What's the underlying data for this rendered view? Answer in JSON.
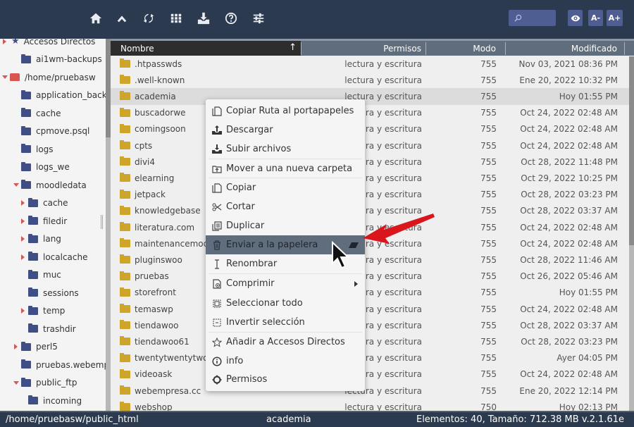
{
  "toolbar": {
    "icons": [
      {
        "name": "home-icon"
      },
      {
        "name": "up-icon"
      },
      {
        "name": "refresh-icon"
      },
      {
        "name": "grid-view-icon"
      },
      {
        "name": "download-icon"
      },
      {
        "name": "help-icon"
      },
      {
        "name": "settings-sliders-icon"
      }
    ],
    "search_placeholder": "",
    "font_decrease_label": "A-",
    "font_increase_label": "A+"
  },
  "sidebar": {
    "items": [
      {
        "label": "Accesos Directos",
        "icon": "star-icon",
        "arrow": "right",
        "level": 0
      },
      {
        "label": "ai1wm-backups",
        "icon": "folder-icon",
        "arrow": "none",
        "level": 1
      },
      {
        "label": "/home/pruebasw",
        "icon": "drive-icon",
        "arrow": "down",
        "level": 0
      },
      {
        "label": "application_backups",
        "icon": "folder-icon",
        "arrow": "none",
        "level": 1
      },
      {
        "label": "cache",
        "icon": "folder-icon",
        "arrow": "none",
        "level": 1
      },
      {
        "label": "cpmove.psql",
        "icon": "folder-icon",
        "arrow": "none",
        "level": 1
      },
      {
        "label": "logs",
        "icon": "folder-icon",
        "arrow": "none",
        "level": 1
      },
      {
        "label": "logs_we",
        "icon": "folder-icon",
        "arrow": "none",
        "level": 1
      },
      {
        "label": "moodledata",
        "icon": "folder-icon",
        "arrow": "down",
        "level": 1
      },
      {
        "label": "cache",
        "icon": "folder-icon",
        "arrow": "right",
        "level": 2
      },
      {
        "label": "filedir",
        "icon": "folder-icon",
        "arrow": "right",
        "level": 2
      },
      {
        "label": "lang",
        "icon": "folder-icon",
        "arrow": "right",
        "level": 2
      },
      {
        "label": "localcache",
        "icon": "folder-icon",
        "arrow": "right",
        "level": 2
      },
      {
        "label": "muc",
        "icon": "folder-icon",
        "arrow": "none",
        "level": 2
      },
      {
        "label": "sessions",
        "icon": "folder-icon",
        "arrow": "none",
        "level": 2
      },
      {
        "label": "temp",
        "icon": "folder-icon",
        "arrow": "right",
        "level": 2
      },
      {
        "label": "trashdir",
        "icon": "folder-icon",
        "arrow": "none",
        "level": 2
      },
      {
        "label": "perl5",
        "icon": "folder-icon",
        "arrow": "right",
        "level": 1
      },
      {
        "label": "pruebas.webempresa",
        "icon": "folder-icon",
        "arrow": "none",
        "level": 1
      },
      {
        "label": "public_ftp",
        "icon": "folder-icon",
        "arrow": "down",
        "level": 1
      },
      {
        "label": "incoming",
        "icon": "folder-icon",
        "arrow": "none",
        "level": 2
      }
    ]
  },
  "table": {
    "columns": {
      "name": "Nombre",
      "perm": "Permisos",
      "mode": "Modo",
      "mod": "Modificado"
    },
    "sort_indicator": "↑",
    "selected_row": "academia",
    "rows": [
      {
        "name": ".htpasswds",
        "perm": "lectura y escritura",
        "mode": "755",
        "mod": "Nov 03, 2021 08:36 PM"
      },
      {
        "name": ".well-known",
        "perm": "lectura y escritura",
        "mode": "755",
        "mod": "Ene 20, 2022 10:32 PM"
      },
      {
        "name": "academia",
        "perm": "lectura y escritura",
        "mode": "755",
        "mod": "Hoy 01:55 PM"
      },
      {
        "name": "buscadorwe",
        "perm": "lectura y escritura",
        "mode": "755",
        "mod": "Oct 24, 2022 02:48 AM"
      },
      {
        "name": "comingsoon",
        "perm": "lectura y escritura",
        "mode": "755",
        "mod": "Oct 24, 2022 02:48 AM"
      },
      {
        "name": "cpts",
        "perm": "lectura y escritura",
        "mode": "755",
        "mod": "Oct 24, 2022 02:48 AM"
      },
      {
        "name": "divi4",
        "perm": "lectura y escritura",
        "mode": "755",
        "mod": "Oct 28, 2022 11:48 PM"
      },
      {
        "name": "elearning",
        "perm": "lectura y escritura",
        "mode": "755",
        "mod": "Oct 29, 2022 10:25 PM"
      },
      {
        "name": "jetpack",
        "perm": "lectura y escritura",
        "mode": "755",
        "mod": "Oct 28, 2022 03:23 PM"
      },
      {
        "name": "knowledgebase",
        "perm": "lectura y escritura",
        "mode": "755",
        "mod": "Oct 28, 2022 03:37 AM"
      },
      {
        "name": "literatura.com",
        "perm": "lectura y escritura",
        "mode": "755",
        "mod": "Oct 24, 2022 02:48 AM"
      },
      {
        "name": "maintenancemode",
        "perm": "lectura y escritura",
        "mode": "755",
        "mod": "Oct 24, 2022 02:48 AM"
      },
      {
        "name": "pluginswoo",
        "perm": "lectura y escritura",
        "mode": "755",
        "mod": "Oct 28, 2022 11:46 AM"
      },
      {
        "name": "pruebas",
        "perm": "lectura y escritura",
        "mode": "755",
        "mod": "Oct 26, 2022 05:46 AM"
      },
      {
        "name": "storefront",
        "perm": "lectura y escritura",
        "mode": "755",
        "mod": "Hoy 01:55 PM"
      },
      {
        "name": "temaswp",
        "perm": "lectura y escritura",
        "mode": "755",
        "mod": "Oct 24, 2022 02:48 AM"
      },
      {
        "name": "tiendawoo",
        "perm": "lectura y escritura",
        "mode": "755",
        "mod": "Oct 28, 2022 03:37 AM"
      },
      {
        "name": "tiendawoo61",
        "perm": "lectura y escritura",
        "mode": "755",
        "mod": "Oct 28, 2022 03:23 PM"
      },
      {
        "name": "twentytwentytwo",
        "perm": "lectura y escritura",
        "mode": "755",
        "mod": "Ayer 04:05 PM"
      },
      {
        "name": "videoask",
        "perm": "lectura y escritura",
        "mode": "755",
        "mod": "Oct 24, 2022 02:48 AM"
      },
      {
        "name": "webempresa.cc",
        "perm": "lectura y escritura",
        "mode": "755",
        "mod": "Ene 20, 2022 12:14 PM"
      },
      {
        "name": "webshop",
        "perm": "lectura y escritura",
        "mode": "750",
        "mod": "Hoy 02:13 PM"
      }
    ]
  },
  "context_menu": {
    "items": [
      {
        "label": "Copiar Ruta al portapapeles",
        "icon": "copy-path-icon"
      },
      {
        "label": "Descargar",
        "icon": "download-icon"
      },
      {
        "label": "Subir archivos",
        "icon": "upload-icon"
      },
      {
        "label": "Mover a una nueva carpeta",
        "icon": "move-folder-icon"
      },
      {
        "label": "Copiar",
        "icon": "copy-icon"
      },
      {
        "label": "Cortar",
        "icon": "scissors-icon"
      },
      {
        "label": "Duplicar",
        "icon": "duplicate-icon"
      },
      {
        "label": "Enviar a la papelera",
        "icon": "trash-icon",
        "highlighted": true,
        "shortcut_icon": "eraser-icon"
      },
      {
        "label": "Renombrar",
        "icon": "rename-cursor-icon"
      },
      {
        "label": "Comprimir",
        "icon": "compress-icon",
        "submenu": true
      },
      {
        "label": "Seleccionar todo",
        "icon": "select-all-icon"
      },
      {
        "label": "Invertir selección",
        "icon": "invert-selection-icon"
      },
      {
        "label": "Añadir a Accesos Directos",
        "icon": "star-outline-icon"
      },
      {
        "label": "info",
        "icon": "info-icon"
      },
      {
        "label": "Permisos",
        "icon": "gear-icon"
      }
    ]
  },
  "statusbar": {
    "path": "/home/pruebasw/public_html",
    "selected": "academia",
    "summary": "Elementos: 40, Tamaño: 712.38 MB v.2.1.61e"
  },
  "colors": {
    "toolbar_bg": "#2b3a4f",
    "button_bg": "#4e5d92",
    "folder_yellow": "#cca52a",
    "tree_folder": "#3f4f86",
    "header_bg": "#5f6d7c",
    "highlight": "#5f6d7c",
    "annotation_arrow": "#d9161b"
  }
}
